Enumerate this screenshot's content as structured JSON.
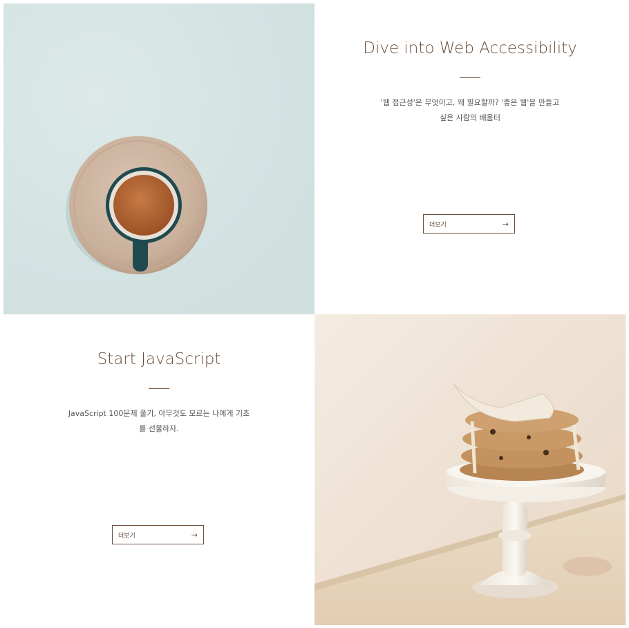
{
  "cards": [
    {
      "title": "Dive into Web Accessibility",
      "description": "'웹 접근성'은 무엇이고, 왜 필요할까? '좋은 웹'을 만들고 싶은 사람의 배움터",
      "button_label": "더보기",
      "button_icon": "arrow-right-icon"
    },
    {
      "title": "Start JavaScript",
      "description": "JavaScript 100문제 풀기, 아무것도 모르는 나에게 기초를 선물하자.",
      "button_label": "더보기",
      "button_icon": "arrow-right-icon"
    }
  ],
  "colors": {
    "accent": "#6b4e3a",
    "coffee_background": "#d8e6e6",
    "cookie_background": "#efe2d2"
  }
}
